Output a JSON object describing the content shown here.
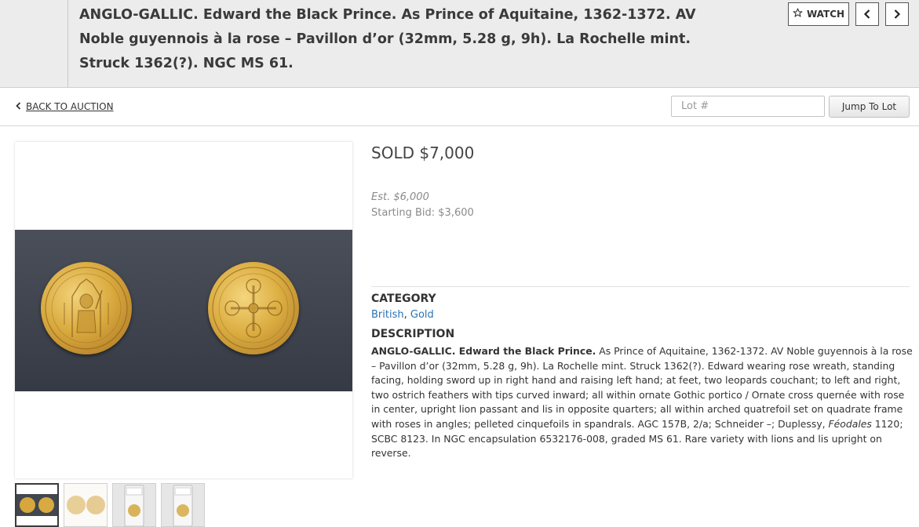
{
  "header": {
    "title": "ANGLO-GALLIC. Edward the Black Prince. As Prince of Aquitaine, 1362-1372. AV Noble guyennois à la rose – Pavillon d’or (32mm, 5.28 g, 9h). La Rochelle mint. Struck 1362(?). NGC MS 61.",
    "watch_label": "WATCH",
    "watch_icon": "star-outline-icon",
    "prev_icon": "chevron-left-icon",
    "next_icon": "chevron-right-icon"
  },
  "subbar": {
    "back_label": "BACK TO AUCTION",
    "lot_placeholder": "Lot #",
    "jump_label": "Jump To Lot"
  },
  "gallery": {
    "thumbnails": [
      "coins-obverse-reverse",
      "coins-light-background",
      "ngc-slab-front",
      "ngc-slab-back"
    ],
    "active_index": 0
  },
  "lot": {
    "sold_label": "SOLD $7,000",
    "estimate": "Est. $6,000",
    "starting_bid": "Starting Bid: $3,600",
    "category_heading": "CATEGORY",
    "categories": [
      "British",
      "Gold"
    ],
    "category_separator": ", ",
    "description_heading": "DESCRIPTION",
    "description_lead": "ANGLO-GALLIC. Edward the Black Prince.",
    "description_part1": " As Prince of Aquitaine, 1362-1372. AV Noble guyennois à la rose – Pavillon d’or (32mm, 5.28 g, 9h). La Rochelle mint. Struck 1362(?). Edward wearing rose wreath, standing facing, holding sword up in right hand and raising left hand; at feet, two leopards couchant; to left and right, two ostrich feathers with tips curved inward; all within ornate Gothic portico / Ornate cross quernée with rose in center, upright lion passant and lis in opposite quarters; all within arched quatrefoil set on quadrate frame with roses in angles; pelleted cinquefoils in spandrals. AGC 157B, 2/a; Schneider –; Duplessy, ",
    "description_italic": "Féodales",
    "description_part2": " 1120; SCBC 8123. In NGC encapsulation 6532176-008, graded MS 61. Rare variety with lions and lis upright on reverse."
  },
  "colors": {
    "header_bg": "#ececec",
    "link": "#2a72b5",
    "photo_bg": "#3f444f",
    "gold": "#d9aa3e"
  }
}
